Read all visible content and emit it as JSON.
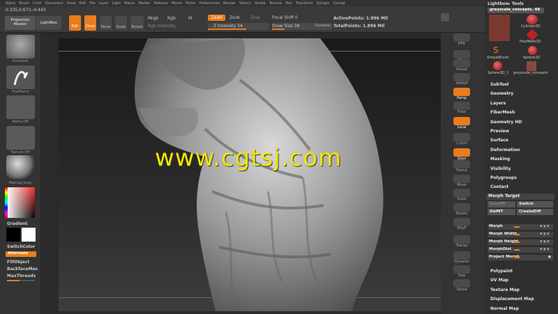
{
  "menu": [
    "Alpha",
    "Brush",
    "Color",
    "Document",
    "Draw",
    "Edit",
    "File",
    "Layer",
    "Light",
    "Macro",
    "Marker",
    "Material",
    "Movie",
    "Picker",
    "Preferences",
    "Render",
    "Stencil",
    "Stroke",
    "Texture",
    "Tool",
    "Transform",
    "Zplugin",
    "Zscript"
  ],
  "toolbar": {
    "coords": "0.335,0.673,-0.443",
    "projection_master": "Projection Master",
    "lightbox": "LightBox",
    "edit": "Edit",
    "draw": "Draw",
    "move": "Move",
    "scale": "Scale",
    "rotate": "Rotate",
    "mrgb": "Mrgb",
    "rgb": "Rgb",
    "m": "M",
    "rgb_intensity": "Rgb Intensity",
    "zadd": "Zadd",
    "zsub": "Zsub",
    "zcut": "Zcut",
    "z_intensity": "Z Intensity 34",
    "focal_shift": "Focal Shift 0",
    "draw_size": "Draw Size 38",
    "dynamic": "Dynamic",
    "active_points": "ActivePoints: 1.896 Mil",
    "total_points": "TotalPoints: 1.896 Mil"
  },
  "left_shelf": {
    "standard": "Standard",
    "freehand": "FreeHand",
    "alpha_off": "Alpha Off",
    "texture_off": "Texture Off",
    "matcap": "MatCap Gray",
    "gradient": "Gradient",
    "switch_color": "SwitchColor",
    "alternate": "Alternate",
    "fill_object": "FillObject",
    "backface": "BackfaceMas",
    "max_threads": "MaxThreads"
  },
  "right_shelf": [
    "BPR",
    "SPix",
    "Actual",
    "AAHalf",
    "Persp",
    "Floor",
    "Local",
    "L.Sym",
    "Qxyz",
    "Frame",
    "Move",
    "Scale",
    "Rotate",
    "PolyF",
    "Transp",
    "Dynamic",
    "Solo",
    "Xpose"
  ],
  "trays": {
    "lightbox_tools": "Lightbox▸ Tools",
    "current_tool": "greyscale_concepts. 48",
    "tools": [
      "Cylinder3D",
      "PolyMesh3D",
      "SimpleBrush",
      "Sphere3D",
      "Sphere3D_1",
      "greyscale_concepts"
    ],
    "sections": [
      "SubTool",
      "Geometry",
      "Layers",
      "FiberMesh",
      "Geometry HD",
      "Preview",
      "Surface",
      "Deformation",
      "Masking",
      "Visibility",
      "Polygroups",
      "Contact"
    ],
    "morph_target": "Morph Target",
    "store_mt": "StoreMT",
    "switch": "Switch",
    "del_mt": "DelMT",
    "create_diff": "CreateDiff",
    "morph_rows": [
      "Morph",
      "Morph Width",
      "Morph Height",
      "MorphDist",
      "Project Morph"
    ],
    "morph_vals": [
      "x y z",
      "x y z",
      "x y z",
      "x y z"
    ],
    "bottom_sections": [
      "Polypaint",
      "UV Map",
      "Texture Map",
      "Displacement Map",
      "Normal Map"
    ]
  },
  "watermark": "www.cgtsj.com",
  "colors": {
    "accent": "#e87d1e",
    "watermark": "#f2e600"
  }
}
